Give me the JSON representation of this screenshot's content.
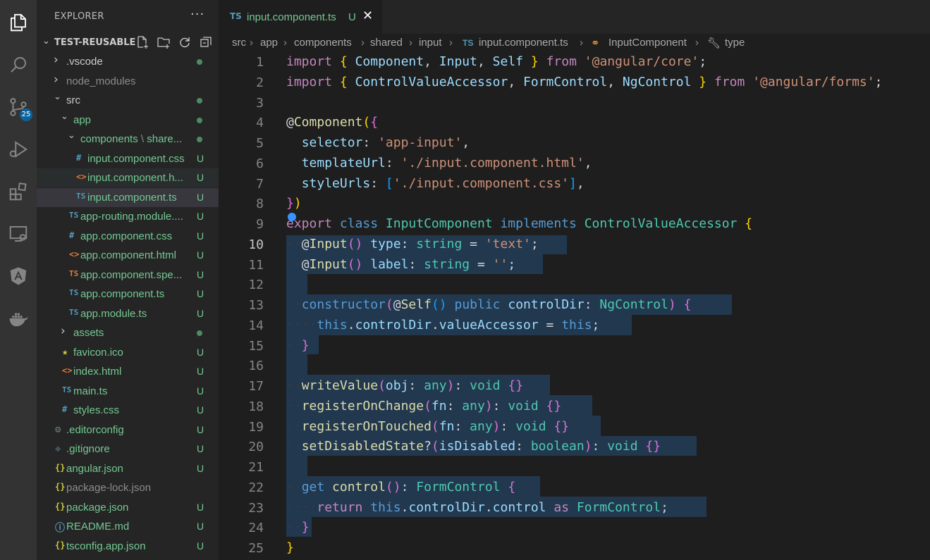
{
  "activity_bar": {
    "items": [
      "explorer-icon",
      "search-icon",
      "source-control-icon",
      "run-debug-icon",
      "extensions-icon",
      "remote-explorer-icon",
      "angular-icon",
      "docker-icon"
    ],
    "scm_badge": "25"
  },
  "sidebar": {
    "title": "EXPLORER",
    "more": "···",
    "project": "TEST-REUSABLE",
    "items": [
      {
        "label": ".vscode",
        "type": "folder",
        "open": false,
        "status": "dot",
        "color": "#cccccc"
      },
      {
        "label": "node_modules",
        "type": "folder",
        "open": false,
        "status": "",
        "color": "#8c8c8c"
      },
      {
        "label": "src",
        "type": "folder",
        "open": true,
        "status": "dot",
        "color": "#cccccc"
      },
      {
        "label": "app",
        "type": "folder",
        "open": true,
        "status": "dot",
        "color": "#73c991"
      },
      {
        "label": "components",
        "label2": "\\",
        "label3": "share...",
        "type": "folder",
        "open": true,
        "status": "dot",
        "color": "#73c991"
      },
      {
        "label": "input.component.css",
        "type": "css",
        "icon": "#",
        "status": "U",
        "color": "#73c991"
      },
      {
        "label": "input.component.h...",
        "type": "html",
        "icon": "<>",
        "status": "U",
        "color": "#73c991"
      },
      {
        "label": "input.component.ts",
        "type": "ts",
        "icon": "TS",
        "status": "U",
        "color": "#73c991"
      },
      {
        "label": "app-routing.module....",
        "type": "ts",
        "icon": "TS",
        "status": "U",
        "color": "#73c991"
      },
      {
        "label": "app.component.css",
        "type": "css",
        "icon": "#",
        "status": "U",
        "color": "#73c991"
      },
      {
        "label": "app.component.html",
        "type": "html",
        "icon": "<>",
        "status": "U",
        "color": "#73c991"
      },
      {
        "label": "app.component.spe...",
        "type": "ts-spec",
        "icon": "TS",
        "status": "U",
        "color": "#73c991"
      },
      {
        "label": "app.component.ts",
        "type": "ts",
        "icon": "TS",
        "status": "U",
        "color": "#73c991"
      },
      {
        "label": "app.module.ts",
        "type": "ts",
        "icon": "TS",
        "status": "U",
        "color": "#73c991"
      },
      {
        "label": "assets",
        "type": "folder",
        "open": false,
        "status": "dot",
        "color": "#73c991"
      },
      {
        "label": "favicon.ico",
        "type": "star",
        "icon": "★",
        "status": "U",
        "color": "#73c991"
      },
      {
        "label": "index.html",
        "type": "html",
        "icon": "<>",
        "status": "U",
        "color": "#73c991"
      },
      {
        "label": "main.ts",
        "type": "ts",
        "icon": "TS",
        "status": "U",
        "color": "#73c991"
      },
      {
        "label": "styles.css",
        "type": "css",
        "icon": "#",
        "status": "U",
        "color": "#73c991"
      },
      {
        "label": ".editorconfig",
        "type": "gear",
        "icon": "⚙",
        "status": "U",
        "color": "#73c991"
      },
      {
        "label": ".gitignore",
        "type": "git",
        "icon": "◆",
        "status": "U",
        "color": "#73c991"
      },
      {
        "label": "angular.json",
        "type": "json",
        "icon": "{}",
        "status": "U",
        "color": "#73c991"
      },
      {
        "label": "package-lock.json",
        "type": "json",
        "icon": "{}",
        "status": "",
        "color": "#8c8c8c"
      },
      {
        "label": "package.json",
        "type": "json",
        "icon": "{}",
        "status": "U",
        "color": "#73c991"
      },
      {
        "label": "README.md",
        "type": "info",
        "icon": "ⓘ",
        "status": "U",
        "color": "#73c991"
      },
      {
        "label": "tsconfig.app.json",
        "type": "json",
        "icon": "{}",
        "status": "U",
        "color": "#73c991"
      }
    ]
  },
  "tab": {
    "icon": "TS",
    "label": "input.component.ts",
    "status": "U",
    "close": "✕"
  },
  "breadcrumbs": [
    "src",
    "app",
    "components",
    "shared",
    "input",
    "input.component.ts",
    "InputComponent",
    "type"
  ],
  "breadcrumb_icons": {
    "file": "TS"
  },
  "editor": {
    "current_line": 10,
    "line_numbers": [
      "1",
      "2",
      "3",
      "4",
      "5",
      "6",
      "7",
      "8",
      "9",
      "10",
      "11",
      "12",
      "13",
      "14",
      "15",
      "16",
      "17",
      "18",
      "19",
      "20",
      "21",
      "22",
      "23",
      "24",
      "25"
    ]
  },
  "colors": {
    "accent": "#0e639c",
    "untracked": "#73c991",
    "ts": "#519aba",
    "html": "#e37933",
    "css": "#519aba",
    "json": "#cbcb41"
  }
}
